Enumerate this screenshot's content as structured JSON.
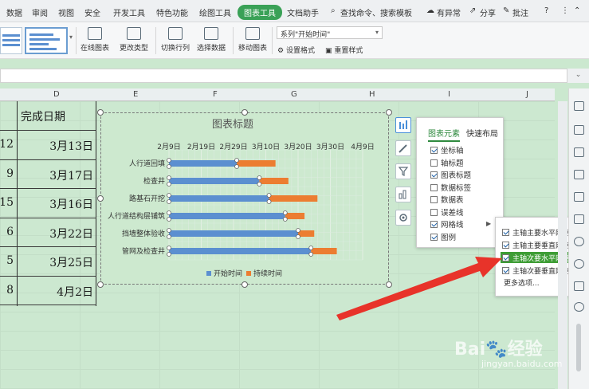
{
  "menubar": {
    "items": [
      "数据",
      "审阅",
      "视图",
      "安全",
      "开发工具",
      "特色功能",
      "绘图工具",
      "图表工具",
      "文档助手"
    ],
    "active": "图表工具",
    "search": "查找命令、搜索模板",
    "right": [
      "有异常",
      "分享",
      "批注"
    ],
    "help": "?"
  },
  "ribbon": {
    "online_chart": "在线图表",
    "change_type": "更改类型",
    "switch_row_col": "切换行列",
    "select_data": "选择数据",
    "move_chart": "移动图表",
    "series_select": "系列\"开始时间\"",
    "set_format": "设置格式",
    "reset_style": "重置样式"
  },
  "columns": [
    "D",
    "E",
    "F",
    "G",
    "H",
    "I",
    "J"
  ],
  "sheet": {
    "header_label": "完成日期",
    "rows": [
      {
        "left": "12",
        "date": "3月13日"
      },
      {
        "left": "9",
        "date": "3月17日"
      },
      {
        "left": "15",
        "date": "3月16日"
      },
      {
        "left": "6",
        "date": "3月22日"
      },
      {
        "left": "5",
        "date": "3月25日"
      },
      {
        "left": "8",
        "date": "4月2日"
      }
    ]
  },
  "chart_data": {
    "type": "bar",
    "orientation": "horizontal-stacked",
    "title": "图表标题",
    "x_ticks": [
      "2月9日",
      "2月19日",
      "2月29日",
      "3月10日",
      "3月20日",
      "3月30日",
      "4月9日"
    ],
    "xlim": [
      "2月9日",
      "4月9日"
    ],
    "categories": [
      "人行道回填",
      "检查井",
      "路基石开挖",
      "人行道结构层铺筑",
      "挡墙整体验收",
      "管网及检查井"
    ],
    "series": [
      {
        "name": "开始时间",
        "color": "#5b8fd0",
        "values": [
          "3月1日",
          "3月8日",
          "3月11日",
          "3月16日",
          "3月20日",
          "3月24日"
        ]
      },
      {
        "name": "持续时间",
        "color": "#ec7d31",
        "values": [
          12,
          9,
          15,
          6,
          5,
          8
        ]
      }
    ],
    "legend_position": "bottom",
    "grid": true
  },
  "panel": {
    "tabs": [
      "图表元素",
      "快速布局"
    ],
    "items": [
      {
        "label": "坐标轴",
        "checked": true
      },
      {
        "label": "轴标题",
        "checked": false
      },
      {
        "label": "图表标题",
        "checked": true
      },
      {
        "label": "数据标签",
        "checked": false
      },
      {
        "label": "数据表",
        "checked": false
      },
      {
        "label": "误差线",
        "checked": false
      },
      {
        "label": "网格线",
        "checked": true
      },
      {
        "label": "图例",
        "checked": true
      }
    ],
    "arrow": "▶"
  },
  "submenu": {
    "items": [
      {
        "label": "主轴主要水平网格线",
        "checked": true
      },
      {
        "label": "主轴主要垂直网格线",
        "checked": true
      },
      {
        "label": "主轴次要水平网格线",
        "checked": true
      },
      {
        "label": "主轴次要垂直网格线",
        "checked": true
      }
    ],
    "more": "更多选项..."
  },
  "watermark": {
    "brand": "Bai",
    "brand2": "经验",
    "url": "jingyan.baidu.com"
  }
}
